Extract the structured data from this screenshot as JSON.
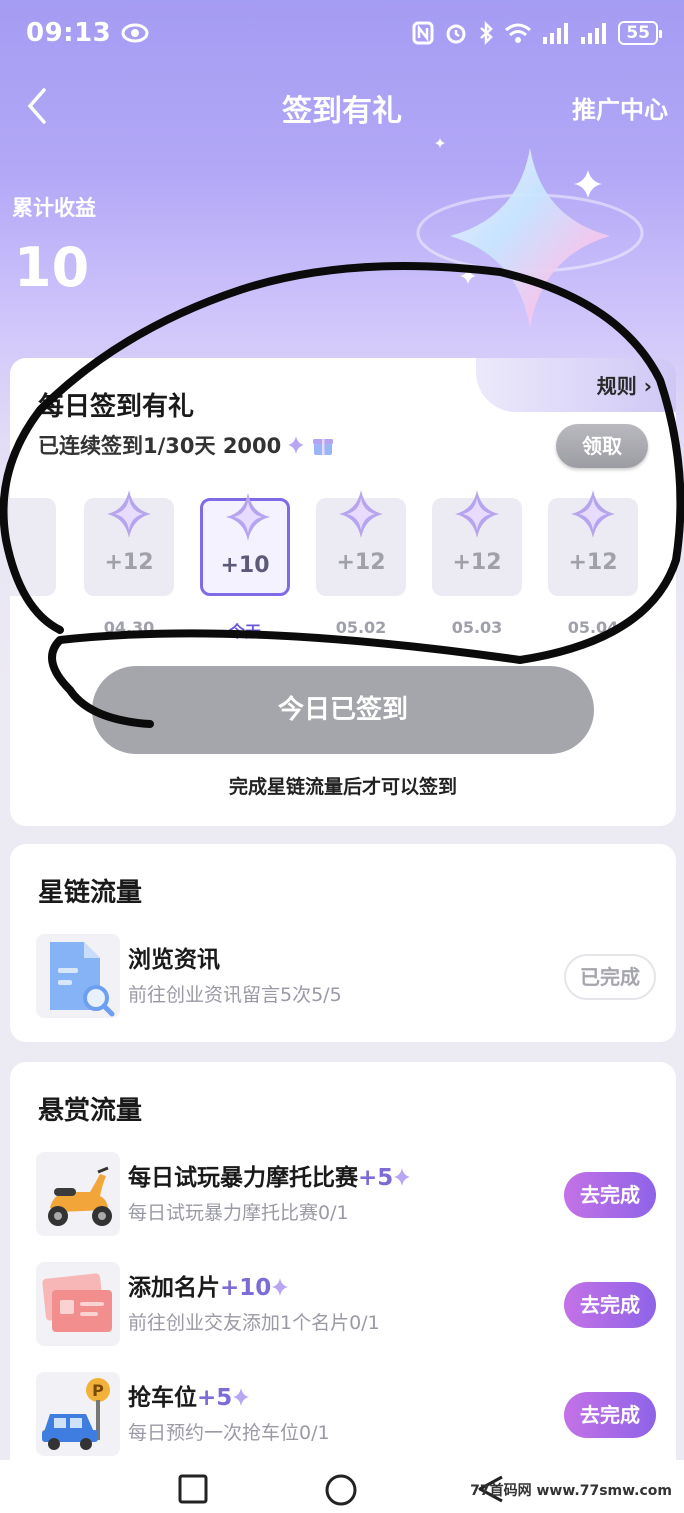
{
  "status_bar": {
    "time": "09:13",
    "battery": "55"
  },
  "header": {
    "title": "签到有礼",
    "right_link": "推广中心"
  },
  "earnings": {
    "label": "累计收益",
    "value": "10"
  },
  "sign_card": {
    "rules_label": "规则",
    "title": "每日签到有礼",
    "streak_text": "已连续签到1/30天 2000",
    "claim_button": "领取",
    "days": [
      {
        "value": "+12",
        "date": "04.30",
        "today": false
      },
      {
        "value": "+10",
        "date": "今天",
        "today": true
      },
      {
        "value": "+12",
        "date": "05.02",
        "today": false
      },
      {
        "value": "+12",
        "date": "05.03",
        "today": false
      },
      {
        "value": "+12",
        "date": "05.04",
        "today": false
      }
    ],
    "signed_button": "今日已签到",
    "note": "完成星链流量后才可以签到"
  },
  "starlink": {
    "title": "星链流量",
    "tasks": [
      {
        "title": "浏览资讯",
        "desc": "前往创业资讯留言5次5/5",
        "button": "已完成"
      }
    ]
  },
  "bounty": {
    "title": "悬赏流量",
    "tasks": [
      {
        "title": "每日试玩暴力摩托比赛",
        "reward": "+5",
        "desc": "每日试玩暴力摩托比赛0/1",
        "button": "去完成"
      },
      {
        "title": "添加名片",
        "reward": "+10",
        "desc": "前往创业交友添加1个名片0/1",
        "button": "去完成"
      },
      {
        "title": "抢车位",
        "reward": "+5",
        "desc": "每日预约一次抢车位0/1",
        "button": "去完成"
      }
    ]
  },
  "watermark": "77首码网 www.77smw.com",
  "colors": {
    "accent": "#7f6ae8",
    "hero_top": "#a59cf3",
    "go_button": "#a96ae7"
  }
}
